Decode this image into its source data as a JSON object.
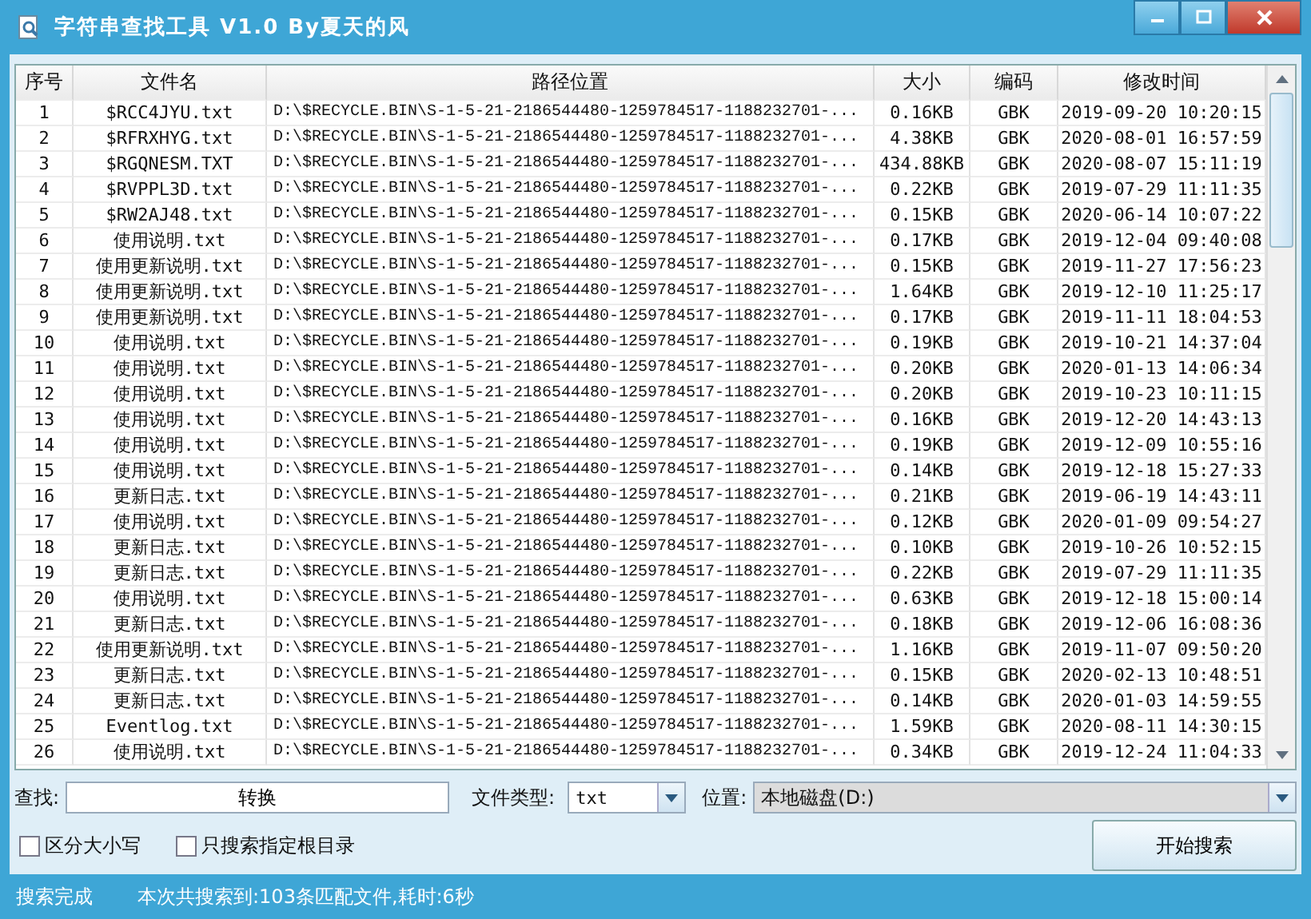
{
  "window": {
    "title": "字符串查找工具 V1.0 By夏天的风"
  },
  "table": {
    "columns": [
      "序号",
      "文件名",
      "路径位置",
      "大小",
      "编码",
      "修改时间"
    ],
    "rows": [
      [
        "1",
        "$RCC4JYU.txt",
        "D:\\$RECYCLE.BIN\\S-1-5-21-2186544480-1259784517-1188232701-...",
        "0.16KB",
        "GBK",
        "2019-09-20 10:20:15"
      ],
      [
        "2",
        "$RFRXHYG.txt",
        "D:\\$RECYCLE.BIN\\S-1-5-21-2186544480-1259784517-1188232701-...",
        "4.38KB",
        "GBK",
        "2020-08-01 16:57:59"
      ],
      [
        "3",
        "$RGQNESM.TXT",
        "D:\\$RECYCLE.BIN\\S-1-5-21-2186544480-1259784517-1188232701-...",
        "434.88KB",
        "GBK",
        "2020-08-07 15:11:19"
      ],
      [
        "4",
        "$RVPPL3D.txt",
        "D:\\$RECYCLE.BIN\\S-1-5-21-2186544480-1259784517-1188232701-...",
        "0.22KB",
        "GBK",
        "2019-07-29 11:11:35"
      ],
      [
        "5",
        "$RW2AJ48.txt",
        "D:\\$RECYCLE.BIN\\S-1-5-21-2186544480-1259784517-1188232701-...",
        "0.15KB",
        "GBK",
        "2020-06-14 10:07:22"
      ],
      [
        "6",
        "使用说明.txt",
        "D:\\$RECYCLE.BIN\\S-1-5-21-2186544480-1259784517-1188232701-...",
        "0.17KB",
        "GBK",
        "2019-12-04 09:40:08"
      ],
      [
        "7",
        "使用更新说明.txt",
        "D:\\$RECYCLE.BIN\\S-1-5-21-2186544480-1259784517-1188232701-...",
        "0.15KB",
        "GBK",
        "2019-11-27 17:56:23"
      ],
      [
        "8",
        "使用更新说明.txt",
        "D:\\$RECYCLE.BIN\\S-1-5-21-2186544480-1259784517-1188232701-...",
        "1.64KB",
        "GBK",
        "2019-12-10 11:25:17"
      ],
      [
        "9",
        "使用更新说明.txt",
        "D:\\$RECYCLE.BIN\\S-1-5-21-2186544480-1259784517-1188232701-...",
        "0.17KB",
        "GBK",
        "2019-11-11 18:04:53"
      ],
      [
        "10",
        "使用说明.txt",
        "D:\\$RECYCLE.BIN\\S-1-5-21-2186544480-1259784517-1188232701-...",
        "0.19KB",
        "GBK",
        "2019-10-21 14:37:04"
      ],
      [
        "11",
        "使用说明.txt",
        "D:\\$RECYCLE.BIN\\S-1-5-21-2186544480-1259784517-1188232701-...",
        "0.20KB",
        "GBK",
        "2020-01-13 14:06:34"
      ],
      [
        "12",
        "使用说明.txt",
        "D:\\$RECYCLE.BIN\\S-1-5-21-2186544480-1259784517-1188232701-...",
        "0.20KB",
        "GBK",
        "2019-10-23 10:11:15"
      ],
      [
        "13",
        "使用说明.txt",
        "D:\\$RECYCLE.BIN\\S-1-5-21-2186544480-1259784517-1188232701-...",
        "0.16KB",
        "GBK",
        "2019-12-20 14:43:13"
      ],
      [
        "14",
        "使用说明.txt",
        "D:\\$RECYCLE.BIN\\S-1-5-21-2186544480-1259784517-1188232701-...",
        "0.19KB",
        "GBK",
        "2019-12-09 10:55:16"
      ],
      [
        "15",
        "使用说明.txt",
        "D:\\$RECYCLE.BIN\\S-1-5-21-2186544480-1259784517-1188232701-...",
        "0.14KB",
        "GBK",
        "2019-12-18 15:27:33"
      ],
      [
        "16",
        "更新日志.txt",
        "D:\\$RECYCLE.BIN\\S-1-5-21-2186544480-1259784517-1188232701-...",
        "0.21KB",
        "GBK",
        "2019-06-19 14:43:11"
      ],
      [
        "17",
        "使用说明.txt",
        "D:\\$RECYCLE.BIN\\S-1-5-21-2186544480-1259784517-1188232701-...",
        "0.12KB",
        "GBK",
        "2020-01-09 09:54:27"
      ],
      [
        "18",
        "更新日志.txt",
        "D:\\$RECYCLE.BIN\\S-1-5-21-2186544480-1259784517-1188232701-...",
        "0.10KB",
        "GBK",
        "2019-10-26 10:52:15"
      ],
      [
        "19",
        "更新日志.txt",
        "D:\\$RECYCLE.BIN\\S-1-5-21-2186544480-1259784517-1188232701-...",
        "0.22KB",
        "GBK",
        "2019-07-29 11:11:35"
      ],
      [
        "20",
        "使用说明.txt",
        "D:\\$RECYCLE.BIN\\S-1-5-21-2186544480-1259784517-1188232701-...",
        "0.63KB",
        "GBK",
        "2019-12-18 15:00:14"
      ],
      [
        "21",
        "更新日志.txt",
        "D:\\$RECYCLE.BIN\\S-1-5-21-2186544480-1259784517-1188232701-...",
        "0.18KB",
        "GBK",
        "2019-12-06 16:08:36"
      ],
      [
        "22",
        "使用更新说明.txt",
        "D:\\$RECYCLE.BIN\\S-1-5-21-2186544480-1259784517-1188232701-...",
        "1.16KB",
        "GBK",
        "2019-11-07 09:50:20"
      ],
      [
        "23",
        "更新日志.txt",
        "D:\\$RECYCLE.BIN\\S-1-5-21-2186544480-1259784517-1188232701-...",
        "0.15KB",
        "GBK",
        "2020-02-13 10:48:51"
      ],
      [
        "24",
        "更新日志.txt",
        "D:\\$RECYCLE.BIN\\S-1-5-21-2186544480-1259784517-1188232701-...",
        "0.14KB",
        "GBK",
        "2020-01-03 14:59:55"
      ],
      [
        "25",
        "Eventlog.txt",
        "D:\\$RECYCLE.BIN\\S-1-5-21-2186544480-1259784517-1188232701-...",
        "1.59KB",
        "GBK",
        "2020-08-11 14:30:15"
      ],
      [
        "26",
        "使用说明.txt",
        "D:\\$RECYCLE.BIN\\S-1-5-21-2186544480-1259784517-1188232701-...",
        "0.34KB",
        "GBK",
        "2019-12-24 11:04:33"
      ]
    ]
  },
  "search": {
    "label": "查找:",
    "value": "转换"
  },
  "file_type": {
    "label": "文件类型:",
    "value": "txt"
  },
  "location": {
    "label": "位置:",
    "value": "本地磁盘(D:)",
    "disabled": true
  },
  "options": [
    {
      "label": "区分大小写",
      "checked": false
    },
    {
      "label": "只搜索指定根目录",
      "checked": false
    }
  ],
  "start_button": "开始搜索",
  "status_bar": [
    "搜索完成",
    "本次共搜索到:103条匹配文件,耗时:6秒"
  ]
}
